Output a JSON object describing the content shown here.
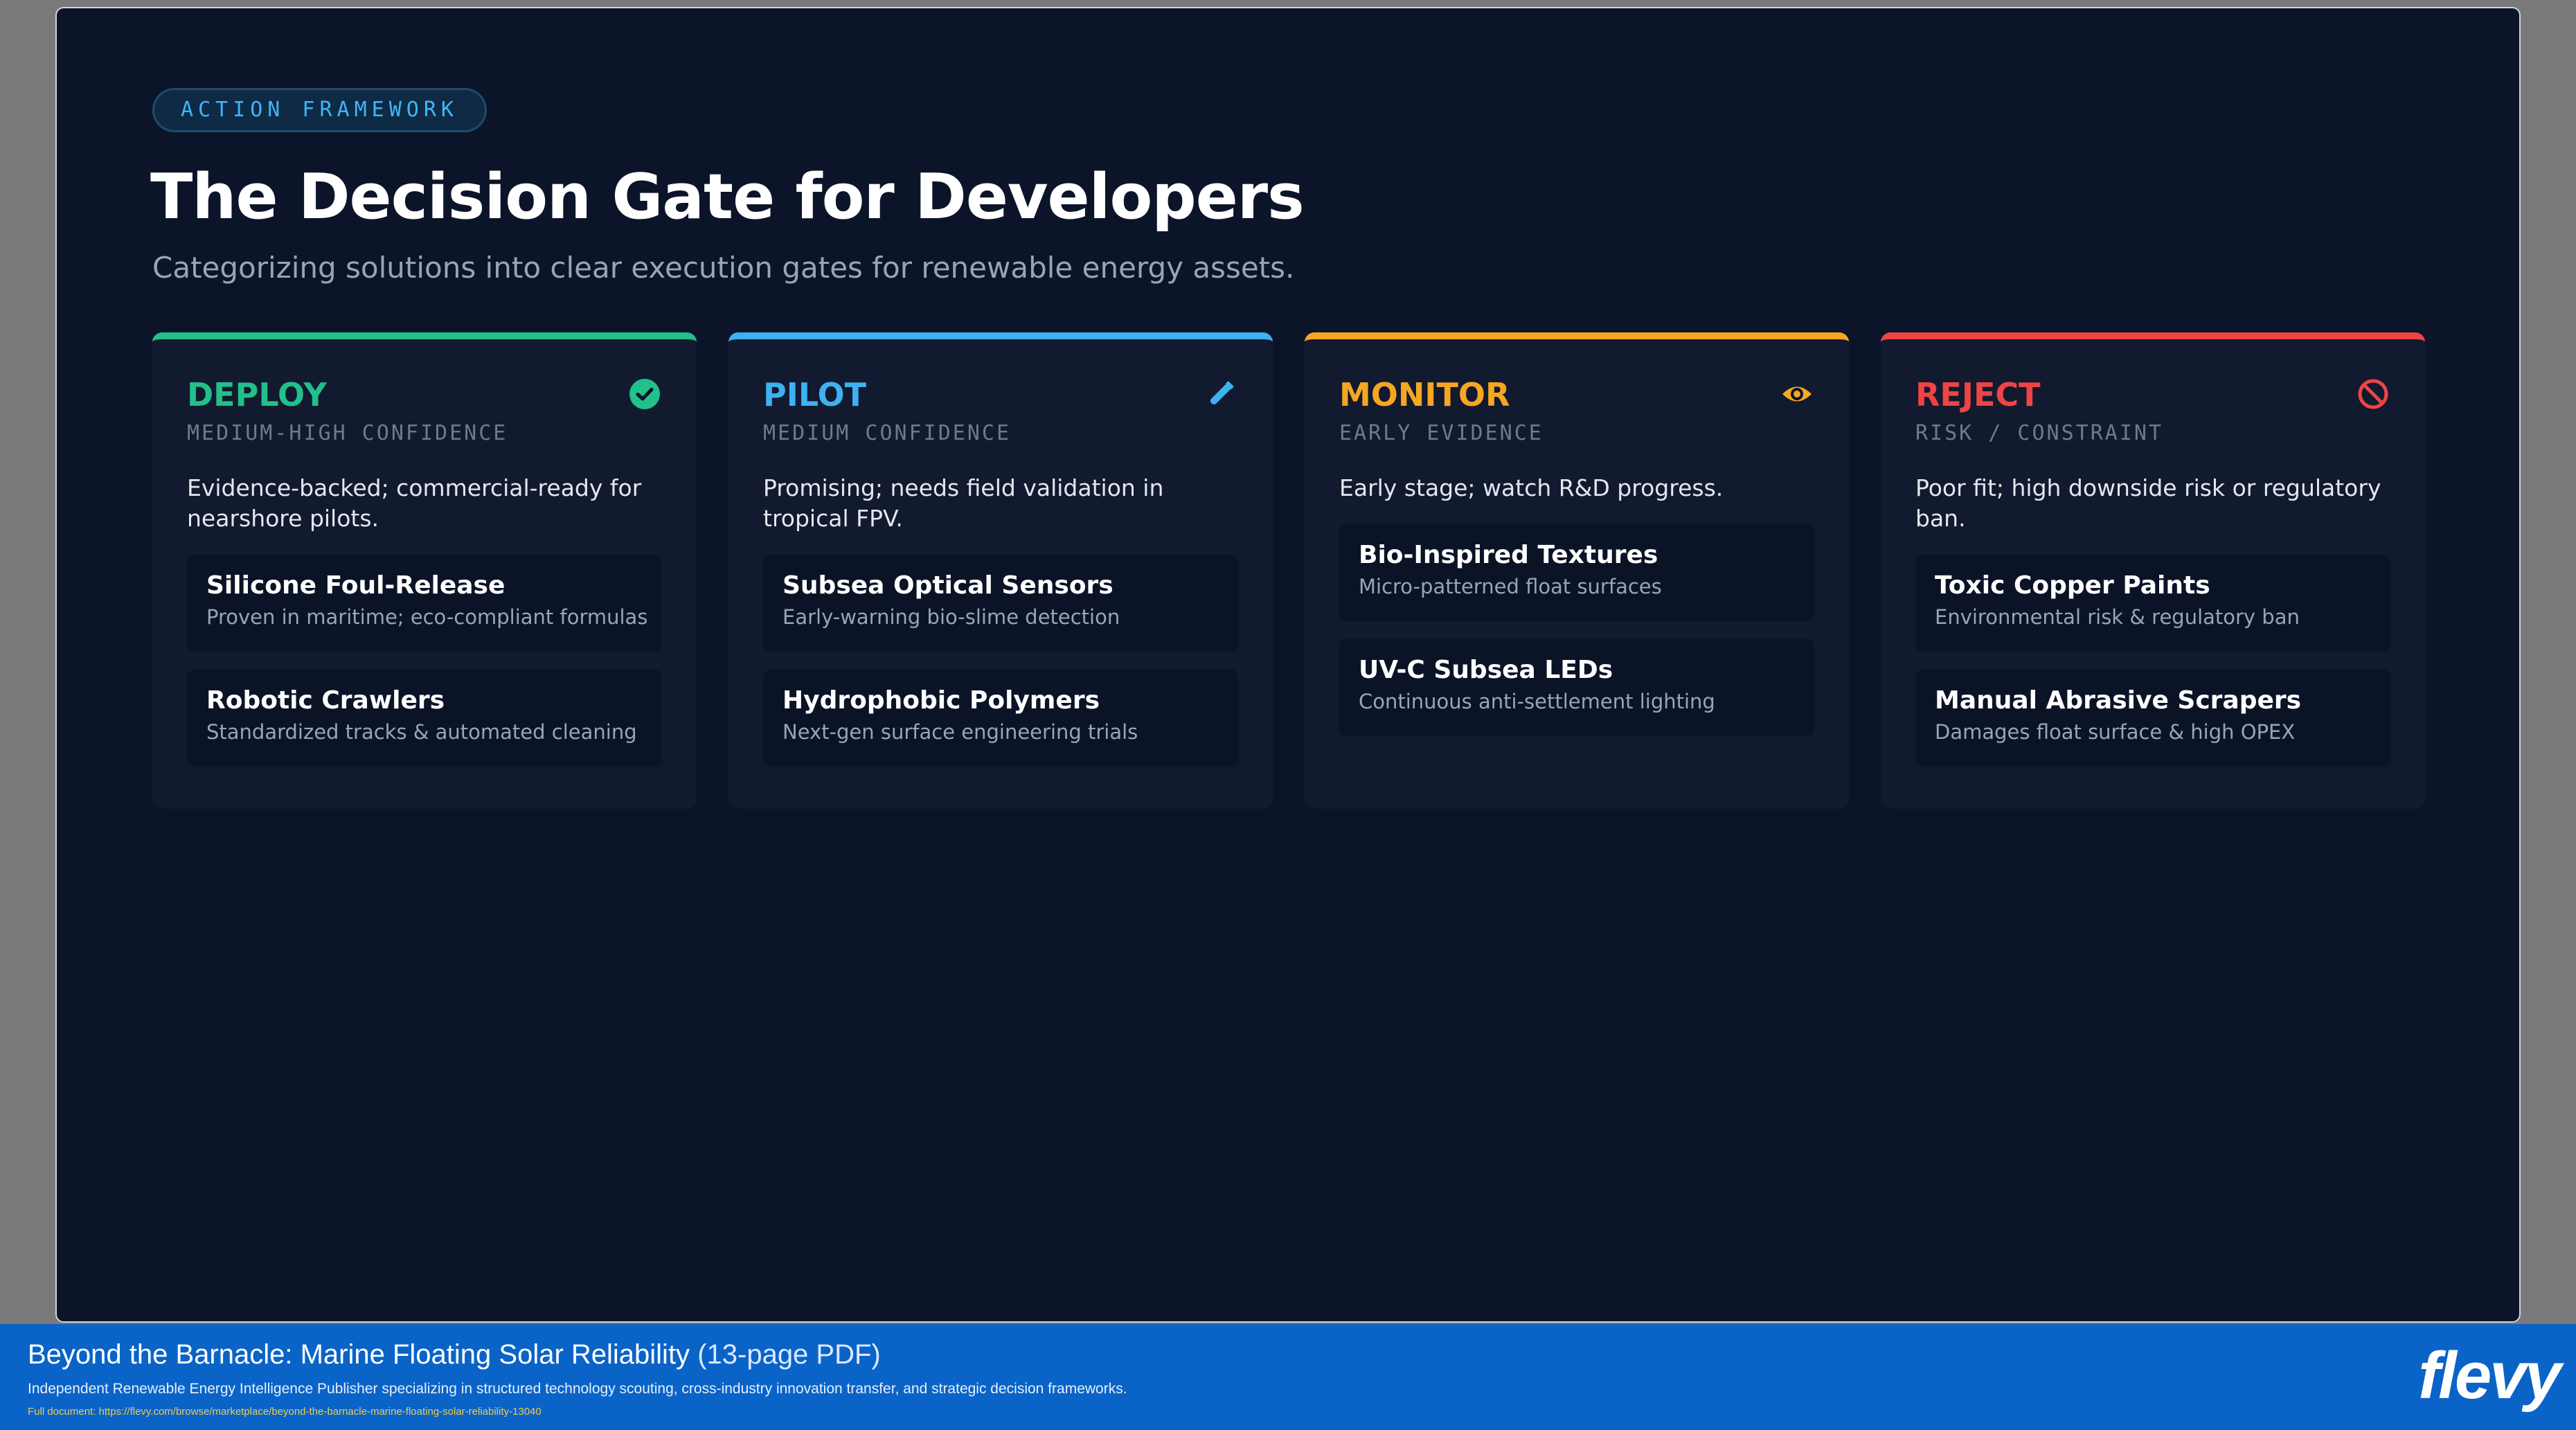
{
  "slide": {
    "tag": "ACTION FRAMEWORK",
    "title": "The Decision Gate for Developers",
    "subtitle": "Categorizing solutions into clear execution gates for renewable energy assets."
  },
  "cards": [
    {
      "title": "DEPLOY",
      "confidence": "MEDIUM-HIGH CONFIDENCE",
      "description": "Evidence-backed; commercial-ready for nearshore pilots.",
      "icon": "check-circle-icon",
      "color": "#22c08a",
      "items": [
        {
          "name": "Silicone Foul-Release",
          "desc": "Proven in maritime; eco-compliant formulas"
        },
        {
          "name": "Robotic Crawlers",
          "desc": "Standardized tracks & automated cleaning"
        }
      ]
    },
    {
      "title": "PILOT",
      "confidence": "MEDIUM CONFIDENCE",
      "description": "Promising; needs field validation in tropical FPV.",
      "icon": "flask-icon",
      "color": "#3fb0f0",
      "items": [
        {
          "name": "Subsea Optical Sensors",
          "desc": "Early-warning bio-slime detection"
        },
        {
          "name": "Hydrophobic Polymers",
          "desc": "Next-gen surface engineering trials"
        }
      ]
    },
    {
      "title": "MONITOR",
      "confidence": "EARLY EVIDENCE",
      "description": "Early stage; watch R&D progress.",
      "icon": "eye-icon",
      "color": "#f5a623",
      "items": [
        {
          "name": "Bio-Inspired Textures",
          "desc": "Micro-patterned float surfaces"
        },
        {
          "name": "UV-C Subsea LEDs",
          "desc": "Continuous anti-settlement lighting"
        }
      ]
    },
    {
      "title": "REJECT",
      "confidence": "RISK / CONSTRAINT",
      "description": "Poor fit; high downside risk or regulatory ban.",
      "icon": "ban-icon",
      "color": "#ef4444",
      "items": [
        {
          "name": "Toxic Copper Paints",
          "desc": "Environmental risk & regulatory ban"
        },
        {
          "name": "Manual Abrasive Scrapers",
          "desc": "Damages float surface & high OPEX"
        }
      ]
    }
  ],
  "footer": {
    "title": "Beyond the Barnacle: Marine Floating Solar Reliability",
    "pages": "(13-page PDF)",
    "description": "Independent Renewable Energy Intelligence Publisher specializing in structured technology scouting, cross-industry innovation transfer, and strategic decision frameworks.",
    "link": "Full document: https://flevy.com/browse/marketplace/beyond-the-barnacle-marine-floating-solar-reliability-13040",
    "logo": "flevy"
  }
}
